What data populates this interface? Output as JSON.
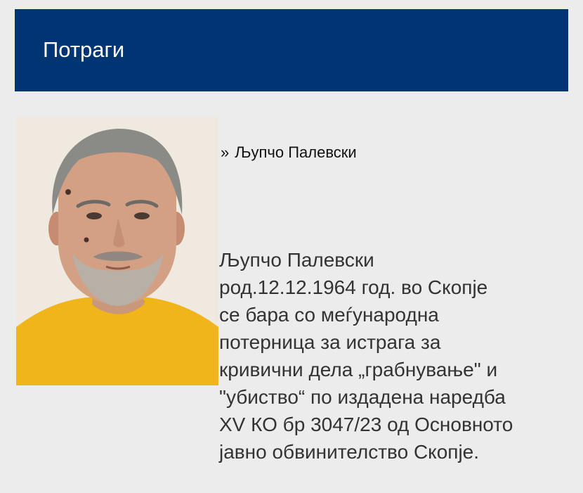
{
  "header": {
    "title": "Потраги"
  },
  "person": {
    "photo_alt": "",
    "link_label": "Љупчо Палевски",
    "arrow_icon": "double-chevron-right-icon",
    "description_lines": [
      "Љупчо Палевски",
      "род.12.12.1964 год. во Скопје",
      "се бара со меѓународна",
      "потерница за истрага за",
      "кривични дела „грабнување\" и",
      "\"убиство“ по издадена наредба",
      "XV КО бр 3047/23 од Основното",
      "јавно обвинителство Скопје."
    ]
  },
  "colors": {
    "header_bg": "#003574",
    "page_bg": "#ececec",
    "text": "#333333"
  }
}
